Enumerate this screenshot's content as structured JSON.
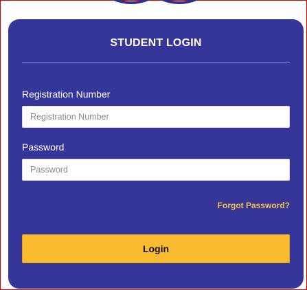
{
  "login": {
    "title": "STUDENT LOGIN",
    "registration": {
      "label": "Registration Number",
      "placeholder": "Registration Number",
      "value": ""
    },
    "password": {
      "label": "Password",
      "placeholder": "Password",
      "value": ""
    },
    "forgot_password": "Forgot Password?",
    "submit_label": "Login"
  },
  "colors": {
    "card_background": "#36369a",
    "button": "#fbbb2e",
    "link": "#f3c24a",
    "frame_border": "#d40000"
  },
  "icons": [
    "logo-arc-icon"
  ]
}
